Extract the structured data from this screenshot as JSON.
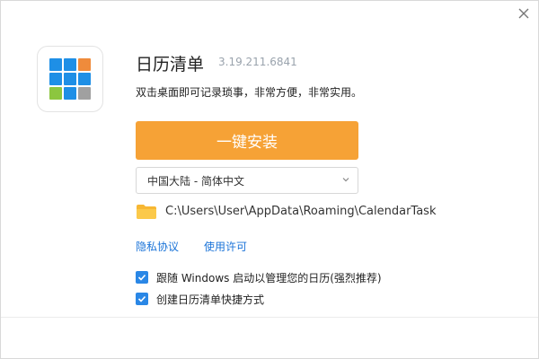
{
  "app": {
    "title": "日历清单",
    "version": "3.19.211.6841",
    "tagline": "双击桌面即可记录琐事，非常方便，非常实用。"
  },
  "install_button": {
    "label": "一键安装"
  },
  "language_select": {
    "selected": "中国大陆 - 简体中文"
  },
  "install_path": {
    "value": "C:\\Users\\User\\AppData\\Roaming\\CalendarTask"
  },
  "links": {
    "privacy": "隐私协议",
    "license": "使用许可"
  },
  "options": [
    {
      "label": "跟随 Windows 启动以管理您的日历(强烈推荐)",
      "checked": true
    },
    {
      "label": "创建日历清单快捷方式",
      "checked": true
    }
  ],
  "colors": {
    "accent_orange": "#f6a236",
    "checkbox_blue": "#2a87e6",
    "link_blue": "#1a73d8",
    "logo_blue": "#1e8fe6",
    "logo_orange": "#ef8b3b",
    "logo_green": "#8cc63f",
    "logo_gray": "#a0a0a0"
  },
  "icons": [
    "close-icon",
    "app-logo-icon",
    "chevron-down-icon",
    "folder-icon",
    "checkmark-icon"
  ]
}
